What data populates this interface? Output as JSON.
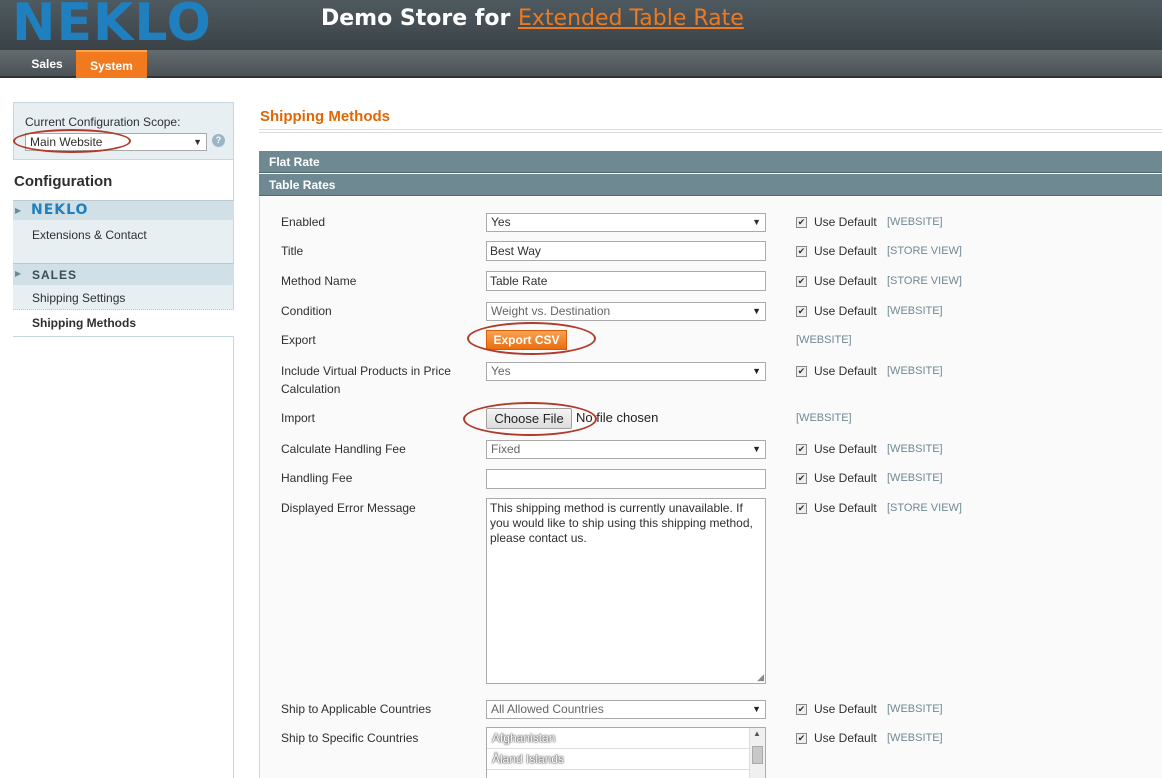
{
  "header": {
    "logo": "NEKLO",
    "store_prefix": "Demo Store for ",
    "store_link": "Extended Table Rate"
  },
  "nav": {
    "tabs": [
      {
        "label": "Sales"
      },
      {
        "label": "System"
      }
    ],
    "active_tab": "System"
  },
  "sidebar": {
    "scope_label": "Current Configuration Scope:",
    "scope_value": "Main Website",
    "config_title": "Configuration",
    "neklo_group": "NEKLO",
    "neklo_item": "Extensions & Contact",
    "sales_group": "SALES",
    "shipping_settings": "Shipping Settings",
    "shipping_methods": "Shipping Methods"
  },
  "main": {
    "page_title": "Shipping Methods",
    "sections": [
      "Flat Rate",
      "Table Rates"
    ],
    "use_default_label": "Use Default",
    "fields": {
      "enabled": {
        "label": "Enabled",
        "value": "Yes",
        "scope": "[WEBSITE]"
      },
      "title": {
        "label": "Title",
        "value": "Best Way",
        "scope": "[STORE VIEW]"
      },
      "method_name": {
        "label": "Method Name",
        "value": "Table Rate",
        "scope": "[STORE VIEW]"
      },
      "condition": {
        "label": "Condition",
        "value": "Weight vs. Destination",
        "scope": "[WEBSITE]"
      },
      "export": {
        "label": "Export",
        "button": "Export CSV",
        "scope": "[WEBSITE]"
      },
      "include_virtual": {
        "label_line1": "Include Virtual Products in Price",
        "label_line2": "Calculation",
        "value": "Yes",
        "scope": "[WEBSITE]"
      },
      "import": {
        "label": "Import",
        "button": "Choose File",
        "status": "No file chosen",
        "scope": "[WEBSITE]"
      },
      "handling_type": {
        "label": "Calculate Handling Fee",
        "value": "Fixed",
        "scope": "[WEBSITE]"
      },
      "handling_fee": {
        "label": "Handling Fee",
        "value": "",
        "scope": "[WEBSITE]"
      },
      "error_message": {
        "label": "Displayed Error Message",
        "value": "This shipping method is currently unavailable. If you would like to ship using this shipping method, please contact us.",
        "scope": "[STORE VIEW]"
      },
      "applicable_countries": {
        "label": "Ship to Applicable Countries",
        "value": "All Allowed Countries",
        "scope": "[WEBSITE]"
      },
      "specific_countries": {
        "label": "Ship to Specific Countries",
        "options": [
          "Afghanistan",
          "Åland Islands"
        ],
        "scope": "[WEBSITE]"
      }
    }
  },
  "icons": {
    "help": "help-icon",
    "dropdown": "chevron-down-icon",
    "checkbox": "checkmark-icon",
    "expand": "triangle-right-icon"
  },
  "colors": {
    "accent": "#f07a1d",
    "brand": "#1f7fbf",
    "section_header": "#6f8992",
    "page_title": "#e26703",
    "annotation": "#b03b2b"
  }
}
